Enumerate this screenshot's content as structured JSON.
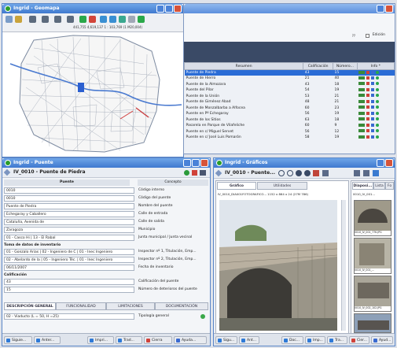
{
  "desktop": {
    "background": "#dfe3ea"
  },
  "geomap": {
    "title": "Ingrid - Geomapa",
    "coords": "441,755 4,619,137 1 : 103,769 (1 M20,004)"
  },
  "results": {
    "edition_label": "Edición",
    "columns": [
      "Resumen",
      "Calificación",
      "Número...",
      "Info *"
    ],
    "rows": [
      {
        "name": "Puente de Piedra",
        "cal": "43",
        "num": "15"
      },
      {
        "name": "Puente de Hierro",
        "cal": "21",
        "num": "40"
      },
      {
        "name": "Puente de la Almozara",
        "cal": "43",
        "num": "18"
      },
      {
        "name": "Puente del Pilar",
        "cal": "54",
        "num": "19"
      },
      {
        "name": "Puente de la Unión",
        "cal": "53",
        "num": "21"
      },
      {
        "name": "Puente de Giménez Abad",
        "cal": "48",
        "num": "21"
      },
      {
        "name": "Puente de Monzalbarba a Alfocea",
        "cal": "60",
        "num": "23"
      },
      {
        "name": "Puente en Pº Echegaray",
        "cal": "56",
        "num": "19"
      },
      {
        "name": "Puente de los Sitios",
        "cal": "63",
        "num": "18"
      },
      {
        "name": "Pasarela en Parque de Vilafeliche",
        "cal": "60",
        "num": "9"
      },
      {
        "name": "Puente en c/ Miguel Servet",
        "cal": "56",
        "num": "12"
      },
      {
        "name": "Puente en c/ José Luis Pomarón",
        "cal": "58",
        "num": "19"
      }
    ]
  },
  "puente": {
    "title": "Ingrid - Puente",
    "header": "IV_0010 - Puente de Piedra",
    "col_puente": "Puente",
    "col_concepto": "Concepto",
    "fields": [
      {
        "value": "0010",
        "label": "Código interno"
      },
      {
        "value": "0010",
        "label": "Código del puente"
      },
      {
        "value": "Puente de Piedra",
        "label": "Nombre del puente"
      },
      {
        "value": "Echegaray y Caballero",
        "label": "Calle de entrada"
      },
      {
        "value": "Cataluña, Avenida de",
        "label": "Calle de salida"
      },
      {
        "value": "Zaragoza",
        "label": "Municipio"
      },
      {
        "value": "01 - Casco Hi | 13 - El Rabal",
        "label": "Junta municipal / Junta vecinal"
      }
    ],
    "section_inventario": "Toma de datos de inventario",
    "inventario": [
      {
        "value": "01 - Gonzalo Arias | 02 - Ingeniero de C | 01 - Inec Ingeniero",
        "label": "Inspector nº 1, Titulación, Emp..."
      },
      {
        "value": "02 - Abelardo de la | 05 - Ingeniero Téc. | 01 - Inec Ingeniero",
        "label": "Inspector nº 2, Titulación, Emp..."
      },
      {
        "value": "06/11/2007",
        "label": "Fecha de inventario"
      }
    ],
    "section_calificacion": "Calificación",
    "calificacion": [
      {
        "value": "43",
        "label": "Calificación del puente"
      },
      {
        "value": "15",
        "label": "Número de deterioros del puente"
      }
    ],
    "tabs": [
      "DESCRIPCIÓN GENERAL",
      "FUNCIONALIDAD",
      "LIMITACIONES",
      "DOCUMENTACIÓN"
    ],
    "tipologia_value": "02 - Viaducto (L = 50, H =25)",
    "tipologia_label": "Tipología general",
    "taskbar": [
      "Siguie...",
      "Anter...",
      "Impri...",
      "Trad...",
      "Cierra",
      "Ayuda..."
    ]
  },
  "graficos": {
    "title": "Ingrid - Gráficos",
    "header": "IV_0010 - Puente...",
    "tab_grafico": "Gráfico",
    "tab_utilidades": "Utilidades",
    "tab_diapos": "Diaposi...",
    "tab_lista": "Lista",
    "tab_fo": "Fo",
    "file_info": "IV_0010_DIA001FOTOGRAFICO...  1152 x 864 x 24 (27M 786)",
    "thumb_header": "0010_IV_001...",
    "thumbs": [
      "0010_IV_001_77K.JPG",
      "0010_IV_001_...",
      "0010_IV_002_102.JPG",
      ""
    ],
    "taskbar": [
      "Sigu...",
      "Ant...",
      "Doc...",
      "Imp...",
      "Tra...",
      "Cier...",
      "Ayud..."
    ]
  }
}
